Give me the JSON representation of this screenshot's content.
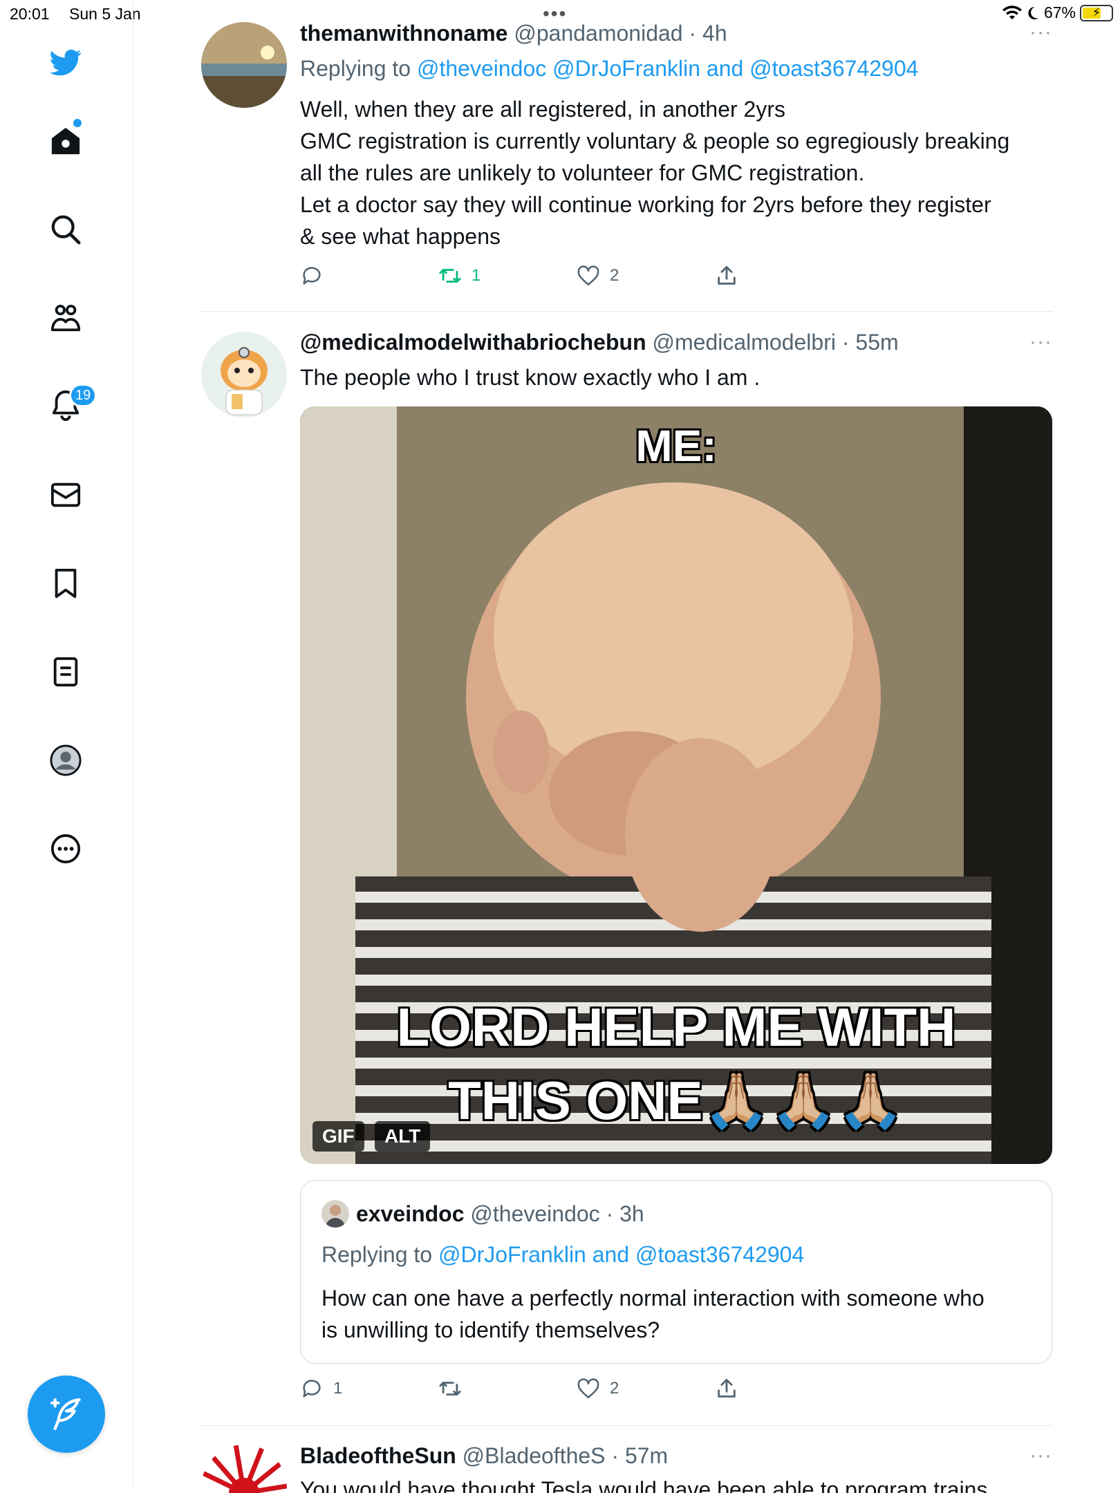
{
  "status_bar": {
    "time": "20:01",
    "date": "Sun 5 Jan",
    "battery": "67%"
  },
  "sidebar": {
    "notifications_badge": "19",
    "items": [
      {
        "icon": "twitter-bird-icon"
      },
      {
        "icon": "home-icon"
      },
      {
        "icon": "search-icon"
      },
      {
        "icon": "communities-icon"
      },
      {
        "icon": "notifications-bell-icon"
      },
      {
        "icon": "messages-envelope-icon"
      },
      {
        "icon": "bookmark-icon"
      },
      {
        "icon": "lists-icon"
      },
      {
        "icon": "profile-avatar-icon"
      },
      {
        "icon": "more-circle-icon"
      }
    ],
    "compose_icon": "compose-feather-icon"
  },
  "tweets": [
    {
      "display_name": "themanwithnoname",
      "handle": "@pandamonidad",
      "time": "· 4h",
      "replying_prefix": "Replying to",
      "replying_to": "@theveindoc @DrJoFranklin and @toast36742904",
      "text_lines": [
        "Well, when they are all registered, in another 2yrs",
        "GMC registration is currently voluntary & people so egregiously breaking",
        "all the rules are unlikely to volunteer for GMC registration.",
        "Let a doctor say they will continue working for 2yrs before they register",
        "& see what happens"
      ],
      "actions": {
        "reply": "",
        "retweet": "1",
        "like": "2"
      }
    },
    {
      "display_name": "@medicalmodelwithabriochebun",
      "handle": "@medicalmodelbri",
      "time": "· 55m",
      "text": "The people who I trust know exactly who I am .",
      "media": {
        "caption_top": "ME:",
        "caption_bottom_1": "LORD HELP ME WITH",
        "caption_bottom_2": "THIS ONE",
        "emoji": "🙏🏼🙏🏼🙏🏼",
        "gif_label": "GIF",
        "alt_label": "ALT"
      },
      "quoted": {
        "display_name": "exveindoc",
        "handle": "@theveindoc",
        "time": "· 3h",
        "replying_prefix": "Replying to",
        "replying_to": "@DrJoFranklin and @toast36742904",
        "text_lines": [
          "How can one have a perfectly normal interaction with someone who",
          "is unwilling to identify themselves?"
        ]
      },
      "actions": {
        "reply": "1",
        "retweet": "",
        "like": "2"
      }
    },
    {
      "display_name": "BladeoftheSun",
      "handle": "@BladeoftheS",
      "time": "· 57m",
      "text": "You would have thought Tesla would have been able to program trains"
    }
  ],
  "more_label": "···"
}
